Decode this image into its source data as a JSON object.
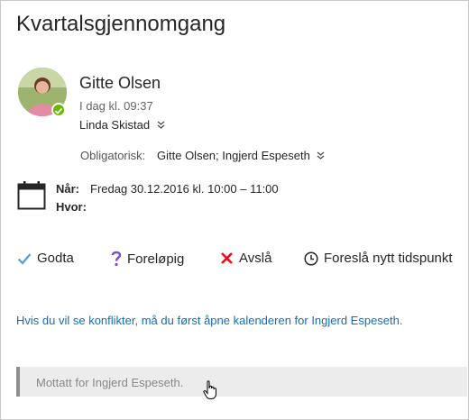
{
  "meeting": {
    "title": "Kvartalsgjennomgang"
  },
  "sender": {
    "name": "Gitte Olsen",
    "time": "I dag kl. 09:37",
    "organizer": "Linda Skistad"
  },
  "attendees": {
    "label": "Obligatorisk:",
    "value": "Gitte Olsen; Ingjerd Espeseth"
  },
  "details": {
    "when_label": "Når:",
    "when_value": "Fredag 30.12.2016 kl. 10:00 – 11:00",
    "where_label": "Hvor:"
  },
  "actions": {
    "accept": "Godta",
    "tentative": "Foreløpig",
    "decline": "Avslå",
    "propose": "Foreslå nytt tidspunkt"
  },
  "conflict_link": "Hvis du vil se konflikter, må du først åpne kalenderen for Ingjerd Espeseth.",
  "notice": "Mottatt for Ingjerd Espeseth.",
  "colors": {
    "accept": "#5b9bd5",
    "tentative": "#7b4fc9",
    "decline": "#e81123",
    "link": "#106ebe",
    "presence": "#6bb700"
  },
  "icons": [
    "checkmark-icon",
    "question-icon",
    "x-icon",
    "clock-icon",
    "calendar-icon",
    "chevron-down-icon",
    "hand-cursor-icon"
  ]
}
